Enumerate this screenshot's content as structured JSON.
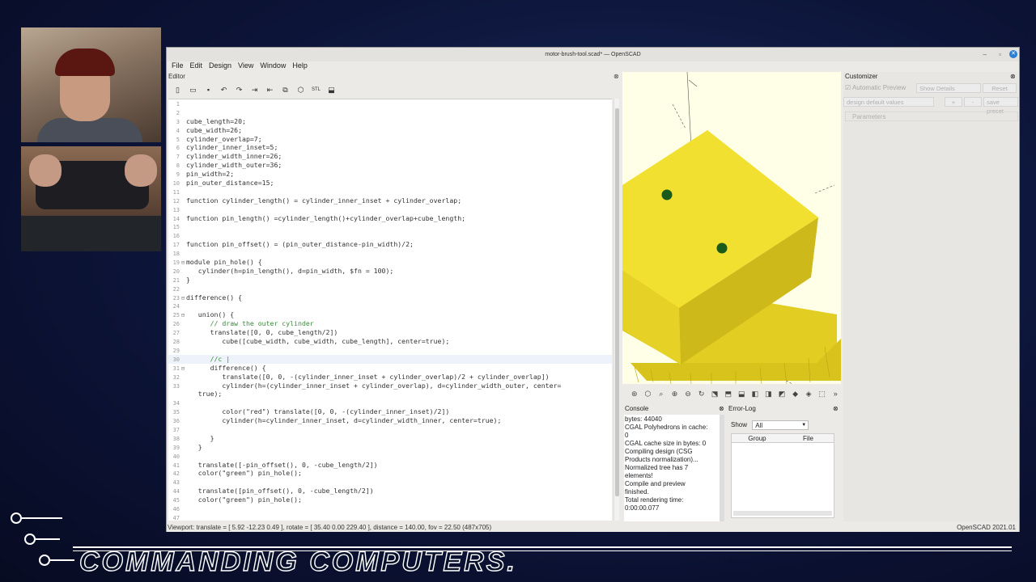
{
  "window": {
    "title": "motor-brush-tool.scad* — OpenSCAD",
    "minimize": "–",
    "maximize": "▫",
    "close": "✕"
  },
  "menu": [
    {
      "label": "File"
    },
    {
      "label": "Edit"
    },
    {
      "label": "Design"
    },
    {
      "label": "View"
    },
    {
      "label": "Window"
    },
    {
      "label": "Help"
    }
  ],
  "editor": {
    "header": "Editor",
    "close": "⊗",
    "toolbar_icons": [
      "new-icon",
      "open-icon",
      "save-icon",
      "undo-icon",
      "redo-icon",
      "indent-icon",
      "unindent-icon",
      "preview-icon",
      "render-icon",
      "export-stl-icon",
      "send-icon"
    ],
    "toolbar_glyphs": [
      "▯",
      "▭",
      "▪",
      "↶",
      "↷",
      "⇥",
      "⇤",
      "⧉",
      "⬡",
      "STL",
      "⬓"
    ],
    "lines": [
      {
        "n": "1",
        "t": ""
      },
      {
        "n": "2",
        "t": ""
      },
      {
        "n": "3",
        "t": "cube_length=20;"
      },
      {
        "n": "4",
        "t": "cube_width=26;"
      },
      {
        "n": "5",
        "t": "cylinder_overlap=7;"
      },
      {
        "n": "6",
        "t": "cylinder_inner_inset=5;"
      },
      {
        "n": "7",
        "t": "cylinder_width_inner=26;"
      },
      {
        "n": "8",
        "t": "cylinder_width_outer=36;"
      },
      {
        "n": "9",
        "t": "pin_width=2;"
      },
      {
        "n": "10",
        "t": "pin_outer_distance=15;"
      },
      {
        "n": "11",
        "t": ""
      },
      {
        "n": "12",
        "t": "function cylinder_length() = cylinder_inner_inset + cylinder_overlap;"
      },
      {
        "n": "13",
        "t": ""
      },
      {
        "n": "14",
        "t": "function pin_length() =cylinder_length()+cylinder_overlap+cube_length;"
      },
      {
        "n": "15",
        "t": ""
      },
      {
        "n": "16",
        "t": ""
      },
      {
        "n": "17",
        "t": "function pin_offset() = (pin_outer_distance-pin_width)/2;"
      },
      {
        "n": "18",
        "t": ""
      },
      {
        "n": "19",
        "t": "module pin_hole() {",
        "fold": "⊟"
      },
      {
        "n": "20",
        "t": "   cylinder(h=pin_length(), d=pin_width, $fn = 100);"
      },
      {
        "n": "21",
        "t": "}"
      },
      {
        "n": "22",
        "t": ""
      },
      {
        "n": "23",
        "t": "difference() {",
        "fold": "⊟"
      },
      {
        "n": "24",
        "t": ""
      },
      {
        "n": "25",
        "t": "   union() {",
        "fold": "⊟"
      },
      {
        "n": "26",
        "t": "      // draw the outer cylinder",
        "c": "#3a8a3a"
      },
      {
        "n": "27",
        "t": "      translate([0, 0, cube_length/2])"
      },
      {
        "n": "28",
        "t": "         cube([cube_width, cube_width, cube_length], center=true);"
      },
      {
        "n": "29",
        "t": ""
      },
      {
        "n": "30",
        "t": "      //c |",
        "c": "#3a8a3a",
        "cur": true
      },
      {
        "n": "31",
        "t": "      difference() {",
        "fold": "⊟"
      },
      {
        "n": "32",
        "t": "         translate([0, 0, -(cylinder_inner_inset + cylinder_overlap)/2 + cylinder_overlap])"
      },
      {
        "n": "33",
        "t": "         cylinder(h=(cylinder_inner_inset + cylinder_overlap), d=cylinder_width_outer, center="
      },
      {
        "n": "",
        "t": "   true);"
      },
      {
        "n": "34",
        "t": ""
      },
      {
        "n": "35",
        "t": "         color(\"red\") translate([0, 0, -(cylinder_inner_inset)/2])"
      },
      {
        "n": "36",
        "t": "         cylinder(h=cylinder_inner_inset, d=cylinder_width_inner, center=true);"
      },
      {
        "n": "37",
        "t": ""
      },
      {
        "n": "38",
        "t": "      }"
      },
      {
        "n": "39",
        "t": "   }"
      },
      {
        "n": "40",
        "t": ""
      },
      {
        "n": "41",
        "t": "   translate([-pin_offset(), 0, -cube_length/2])"
      },
      {
        "n": "42",
        "t": "   color(\"green\") pin_hole();"
      },
      {
        "n": "43",
        "t": ""
      },
      {
        "n": "44",
        "t": "   translate([pin_offset(), 0, -cube_length/2])"
      },
      {
        "n": "45",
        "t": "   color(\"green\") pin_hole();"
      },
      {
        "n": "46",
        "t": ""
      },
      {
        "n": "47",
        "t": ""
      }
    ]
  },
  "viewer_toolbar_icons": [
    "preview-icon",
    "render-icon",
    "zoom-all-icon",
    "zoom-in-icon",
    "zoom-out-icon",
    "reset-view-icon",
    "view-right-icon",
    "view-top-icon",
    "view-bottom-icon",
    "view-left-icon",
    "view-front-icon",
    "view-back-icon",
    "view-diagonal-icon",
    "view-center-icon",
    "perspective-icon",
    "orthogonal-icon"
  ],
  "viewer_toolbar_glyphs": [
    "⊛",
    "⬡",
    "⌕",
    "⊕",
    "⊖",
    "↻",
    "⬔",
    "⬒",
    "⬓",
    "◧",
    "◨",
    "◩",
    "◆",
    "◈",
    "⬚",
    "»"
  ],
  "console": {
    "header": "Console",
    "close": "⊗",
    "lines": [
      "bytes: 44040",
      "CGAL Polyhedrons in cache:",
      "0",
      "CGAL cache size in bytes: 0",
      "Compiling design (CSG",
      "Products normalization)...",
      "Normalized tree has 7",
      "elements!",
      "Compile and preview",
      "finished.",
      "Total rendering time:",
      "0:00:00.077"
    ]
  },
  "errorlog": {
    "header": "Error-Log",
    "close": "⊗",
    "show_label": "Show",
    "show_value": "All",
    "columns": [
      "Group",
      "File"
    ]
  },
  "customizer": {
    "header": "Customizer",
    "close": "⊗",
    "auto_preview": "Automatic Preview",
    "show_details": "Show Details",
    "reset": "Reset",
    "preset": "design default values",
    "plus": "+",
    "minus": "-",
    "save_preset": "save preset",
    "parameters": "Parameters"
  },
  "statusbar": {
    "viewport": "Viewport: translate = [ 5.92 -12.23 0.49 ], rotate = [ 35.40 0.00 229.40 ], distance = 140.00, fov = 22.50 (487x705)",
    "version": "OpenSCAD 2021.01"
  },
  "overlay": {
    "brand": "COMMANDING COMPUTERS."
  },
  "colors": {
    "model_yellow": "#f2e030",
    "model_shade": "#c9b617",
    "pin_green": "#1a5a1a",
    "viewer_bg": "#ffffe8",
    "accent": "#2a7fd4"
  }
}
